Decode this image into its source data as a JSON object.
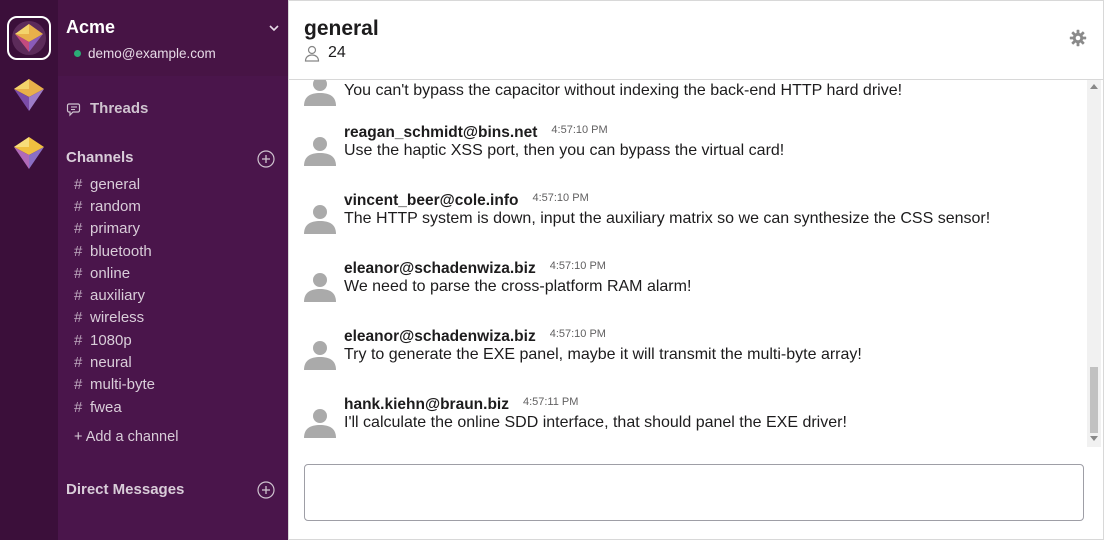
{
  "workspaces": [
    {
      "name": "workspace-1-logo",
      "active": true
    },
    {
      "name": "workspace-2-logo",
      "active": false
    },
    {
      "name": "workspace-3-logo",
      "active": false
    }
  ],
  "team": {
    "name": "Acme",
    "user": "demo@example.com"
  },
  "sidebar": {
    "threads_label": "Threads",
    "channels_title": "Channels",
    "channels": [
      "general",
      "random",
      "primary",
      "bluetooth",
      "online",
      "auxiliary",
      "wireless",
      "1080p",
      "neural",
      "multi-byte",
      "fwea"
    ],
    "add_channel_label": "+ Add a channel",
    "dm_title": "Direct Messages"
  },
  "channel": {
    "name": "general",
    "member_count": "24"
  },
  "messages": [
    {
      "author": "",
      "time": "",
      "text": "You can't bypass the capacitor without indexing the back-end HTTP hard drive!"
    },
    {
      "author": "reagan_schmidt@bins.net",
      "time": "4:57:10 PM",
      "text": "Use the haptic XSS port, then you can bypass the virtual card!"
    },
    {
      "author": "vincent_beer@cole.info",
      "time": "4:57:10 PM",
      "text": "The HTTP system is down, input the auxiliary matrix so we can synthesize the CSS sensor!"
    },
    {
      "author": "eleanor@schadenwiza.biz",
      "time": "4:57:10 PM",
      "text": "We need to parse the cross-platform RAM alarm!"
    },
    {
      "author": "eleanor@schadenwiza.biz",
      "time": "4:57:10 PM",
      "text": "Try to generate the EXE panel, maybe it will transmit the multi-byte array!"
    },
    {
      "author": "hank.kiehn@braun.biz",
      "time": "4:57:11 PM",
      "text": "I'll calculate the online SDD interface, that should panel the EXE driver!"
    }
  ],
  "composer": {
    "value": "",
    "placeholder": ""
  },
  "colors": {
    "rail": "#3b0f3a",
    "sidebar": "#4a154b",
    "presence": "#2bac76"
  },
  "icons": {
    "threads": "threads-icon",
    "add": "add-circle-icon",
    "members": "person-icon",
    "settings": "gear-icon",
    "avatar": "user-avatar-icon"
  }
}
